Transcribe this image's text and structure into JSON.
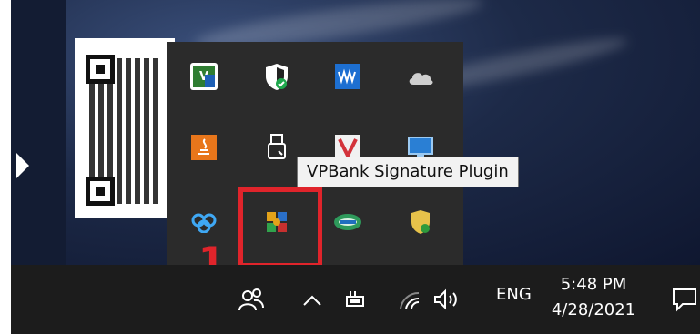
{
  "tooltip": {
    "text": "VPBank Signature Plugin"
  },
  "annotation": {
    "step_number": "1",
    "highlight_color": "#e0242b"
  },
  "tray_popup": {
    "icons": [
      {
        "name": "vnc-viewer-icon"
      },
      {
        "name": "windows-security-icon"
      },
      {
        "name": "audio-waves-app-icon"
      },
      {
        "name": "onedrive-cloud-icon"
      },
      {
        "name": "java-icon"
      },
      {
        "name": "usb-device-icon"
      },
      {
        "name": "red-app-icon"
      },
      {
        "name": "display-app-icon"
      },
      {
        "name": "cloud-sync-icon"
      },
      {
        "name": "vpbank-signature-plugin-icon"
      },
      {
        "name": "green-oval-app-icon"
      },
      {
        "name": "shield-security-icon"
      }
    ]
  },
  "taskbar": {
    "language": "ENG",
    "time": "5:48 PM",
    "date": "4/28/2021",
    "icons": [
      "people-icon",
      "show-hidden-icons-chevron-icon",
      "battery-icon",
      "wifi-icon",
      "volume-icon",
      "action-center-icon"
    ]
  }
}
